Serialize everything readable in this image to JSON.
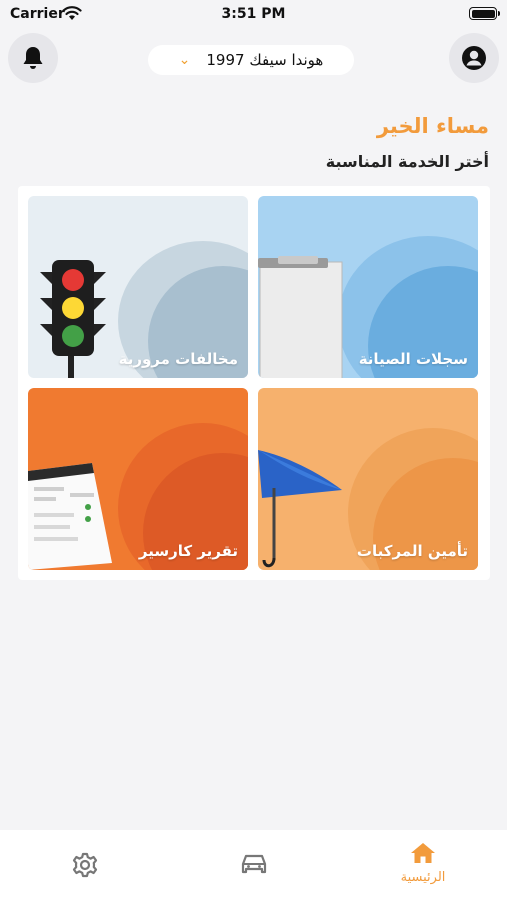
{
  "status_bar": {
    "carrier": "Carrier",
    "time": "3:51 PM"
  },
  "header": {
    "vehicle": "هوندا سيفك 1997",
    "greeting": "مساء الخير",
    "subtitle": "أختر الخدمة المناسبة"
  },
  "services": [
    {
      "label": "سجلات الصيانة"
    },
    {
      "label": "مخالفات مرورية"
    },
    {
      "label": "تأمين المركبات"
    },
    {
      "label": "تقرير كارسير"
    }
  ],
  "bottom_nav": {
    "home_label": "الرئيسية"
  },
  "colors": {
    "accent": "#f29b3c"
  },
  "icons": [
    "bell-icon",
    "profile-icon",
    "chevron-down-icon",
    "home-icon",
    "car-icon",
    "gear-icon"
  ]
}
